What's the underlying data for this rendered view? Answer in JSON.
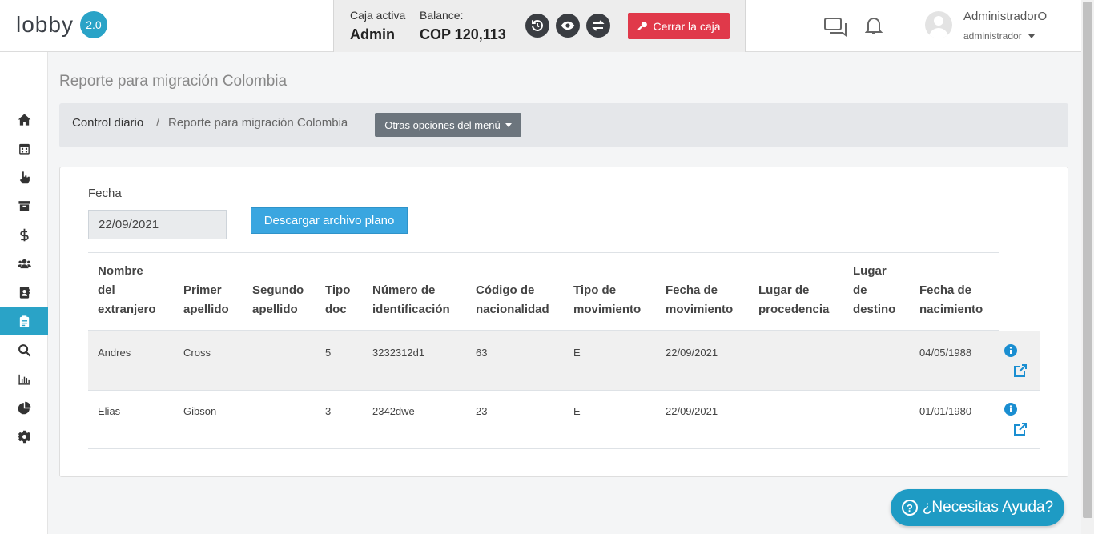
{
  "header": {
    "logo_text": "lobby",
    "logo_version": "2.0",
    "caja_activa_label": "Caja activa",
    "caja_activa_value": "Admin",
    "balance_label": "Balance:",
    "balance_value": "COP 120,113",
    "cerrar_caja_label": "Cerrar la caja",
    "user_name": "AdministradorO",
    "user_role": "administrador"
  },
  "sidebar": {
    "items": [
      {
        "icon": "home-icon"
      },
      {
        "icon": "calendar-icon"
      },
      {
        "icon": "hand-pointer-icon"
      },
      {
        "icon": "archive-icon"
      },
      {
        "icon": "dollar-icon"
      },
      {
        "icon": "users-icon"
      },
      {
        "icon": "address-book-icon"
      },
      {
        "icon": "clipboard-icon",
        "active": true
      },
      {
        "icon": "search-icon"
      },
      {
        "icon": "bar-chart-icon"
      },
      {
        "icon": "pie-chart-icon"
      },
      {
        "icon": "gear-icon"
      }
    ],
    "active_color": "#2aa3c7"
  },
  "page": {
    "title": "Reporte para migración Colombia",
    "breadcrumb": {
      "item1": "Control diario",
      "separator": "/",
      "item2": "Reporte para migración Colombia"
    },
    "menu_dropdown_label": "Otras opciones del menú"
  },
  "form": {
    "fecha_label": "Fecha",
    "fecha_value": "22/09/2021",
    "download_label": "Descargar archivo plano"
  },
  "table": {
    "headers": [
      [
        "Nombre",
        "del",
        "extranjero"
      ],
      [
        "Primer",
        "apellido"
      ],
      [
        "Segundo",
        "apellido"
      ],
      [
        "Tipo",
        "doc"
      ],
      [
        "Número de",
        "identificación"
      ],
      [
        "Código de",
        "nacionalidad"
      ],
      [
        "Tipo de",
        "movimiento"
      ],
      [
        "Fecha de",
        "movimiento"
      ],
      [
        "Lugar de",
        "procedencia"
      ],
      [
        "Lugar",
        "de",
        "destino"
      ],
      [
        "Fecha de",
        "nacimiento"
      ]
    ],
    "rows": [
      [
        "Andres",
        "Cross",
        "",
        "5",
        "3232312d1",
        "63",
        "E",
        "22/09/2021",
        "",
        "",
        "04/05/1988"
      ],
      [
        "Elias",
        "Gibson",
        "",
        "3",
        "2342dwe",
        "23",
        "E",
        "22/09/2021",
        "",
        "",
        "01/01/1980"
      ]
    ]
  },
  "help": {
    "label": "¿Necesitas Ayuda?",
    "color": "#1e9bc4"
  },
  "colors": {
    "accent": "#2aa3c7",
    "danger": "#e0394a",
    "primary_btn": "#3aa6e0",
    "icon_link": "#1a8ed1"
  }
}
